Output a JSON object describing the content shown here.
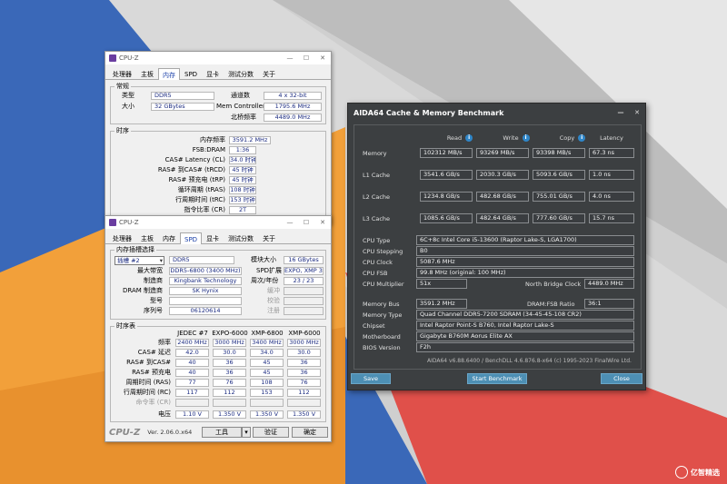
{
  "colors": {
    "bg_blue": "#3a68b8",
    "bg_orange": "#f2a03a",
    "bg_red": "#e0504a",
    "bg_gray": "#c8c8c8",
    "aida_bg": "#3c3f41",
    "aida_btn": "#4d8fb4"
  },
  "cpuz_mem": {
    "title": "CPU-Z",
    "tabs": [
      "处理器",
      "主板",
      "内存",
      "SPD",
      "显卡",
      "测试分数",
      "关于"
    ],
    "general_title": "常规",
    "type_label": "类型",
    "type_value": "DDR5",
    "size_label": "大小",
    "size_value": "32 GBytes",
    "channels_label": "通道数",
    "channels_value": "4 x 32-bit",
    "memctrl_label": "Mem Controller",
    "memctrl_value": "1795.6 MHz",
    "nb_label": "北桥频率",
    "nb_value": "4489.0 MHz",
    "timings_title": "时序",
    "rows": [
      {
        "label": "内存频率",
        "value": "3591.2 MHz"
      },
      {
        "label": "FSB:DRAM",
        "value": "1:36"
      },
      {
        "label": "CAS# Latency (CL)",
        "value": "34.0 时钟"
      },
      {
        "label": "RAS# 到CAS# (tRCD)",
        "value": "45 时钟"
      },
      {
        "label": "RAS# 预充电 (tRP)",
        "value": "45 时钟"
      },
      {
        "label": "循环周期 (tRAS)",
        "value": "108 时钟"
      },
      {
        "label": "行周期时间 (tRC)",
        "value": "153 时钟"
      },
      {
        "label": "指令比率 (CR)",
        "value": "2T"
      }
    ]
  },
  "cpuz_spd": {
    "title": "CPU-Z",
    "tabs": [
      "处理器",
      "主板",
      "内存",
      "SPD",
      "显卡",
      "测试分数",
      "关于"
    ],
    "slot_title": "内存插槽选择",
    "slot_value": "插槽 #2",
    "type_value": "DDR5",
    "module_size_label": "模块大小",
    "module_size_value": "16 GBytes",
    "max_bw_label": "最大带宽",
    "max_bw_value": "DDR5-6800 (3400 MHz)",
    "spd_ext_label": "SPD扩展",
    "spd_ext_value": "EXPO, XMP 3.0",
    "maker_label": "制造商",
    "maker_value": "Kingbank Technology",
    "week_label": "周次/年份",
    "week_value": "23 / 23",
    "dram_label": "DRAM 制造商",
    "dram_value": "SK Hynix",
    "buffered_label": "缓冲",
    "model_label": "型号",
    "check_label": "校验",
    "serial_label": "序列号",
    "serial_value": "06120614",
    "registered_label": "注册",
    "table_title": "时序表",
    "columns": [
      "JEDEC #7",
      "EXPO-6000",
      "XMP-6800",
      "XMP-6000"
    ],
    "timing_rows": [
      {
        "label": "频率",
        "values": [
          "2400 MHz",
          "3000 MHz",
          "3400 MHz",
          "3000 MHz"
        ]
      },
      {
        "label": "CAS# 延迟",
        "values": [
          "42.0",
          "30.0",
          "34.0",
          "30.0"
        ]
      },
      {
        "label": "RAS# 到CAS#",
        "values": [
          "40",
          "36",
          "45",
          "36"
        ]
      },
      {
        "label": "RAS# 预充电",
        "values": [
          "40",
          "36",
          "45",
          "36"
        ]
      },
      {
        "label": "周期时间 (RAS)",
        "values": [
          "77",
          "76",
          "108",
          "76"
        ]
      },
      {
        "label": "行周期时间 (RC)",
        "values": [
          "117",
          "112",
          "153",
          "112"
        ]
      },
      {
        "label": "命令率 (CR)",
        "values": [
          "",
          "",
          "",
          ""
        ]
      },
      {
        "label": "电压",
        "values": [
          "1.10 V",
          "1.350 V",
          "1.350 V",
          "1.350 V"
        ]
      }
    ],
    "footer_logo": "CPU-Z",
    "version": "Ver. 2.06.0.x64",
    "tools_label": "工具",
    "validate_label": "验证",
    "ok_label": "确定"
  },
  "aida": {
    "title": "AIDA64 Cache & Memory Benchmark",
    "headers": [
      "Read",
      "Write",
      "Copy",
      "Latency"
    ],
    "bench_rows": [
      {
        "label": "Memory",
        "values": [
          "102312 MB/s",
          "93269 MB/s",
          "93398 MB/s",
          "67.3 ns"
        ]
      },
      {
        "label": "L1 Cache",
        "values": [
          "3541.6 GB/s",
          "2030.3 GB/s",
          "5093.6 GB/s",
          "1.0 ns"
        ]
      },
      {
        "label": "L2 Cache",
        "values": [
          "1234.8 GB/s",
          "482.68 GB/s",
          "755.01 GB/s",
          "4.0 ns"
        ]
      },
      {
        "label": "L3 Cache",
        "values": [
          "1085.6 GB/s",
          "482.64 GB/s",
          "777.60 GB/s",
          "15.7 ns"
        ]
      }
    ],
    "cpu_type_label": "CPU Type",
    "cpu_type_value": "6C+8c Intel Core i5-13600  (Raptor Lake-S, LGA1700)",
    "cpu_stepping_label": "CPU Stepping",
    "cpu_stepping_value": "B0",
    "cpu_clock_label": "CPU Clock",
    "cpu_clock_value": "5087.6 MHz",
    "cpu_fsb_label": "CPU FSB",
    "cpu_fsb_value": "99.8 MHz  (original: 100 MHz)",
    "cpu_mult_label": "CPU Multiplier",
    "cpu_mult_value": "51x",
    "nb_clock_label": "North Bridge Clock",
    "nb_clock_value": "4489.0 MHz",
    "mem_bus_label": "Memory Bus",
    "mem_bus_value": "3591.2 MHz",
    "dram_fsb_label": "DRAM:FSB Ratio",
    "dram_fsb_value": "36:1",
    "mem_type_label": "Memory Type",
    "mem_type_value": "Quad Channel DDR5-7200 SDRAM  (34-45-45-108 CR2)",
    "chipset_label": "Chipset",
    "chipset_value": "Intel Raptor Point-S B760, Intel Raptor Lake-S",
    "mobo_label": "Motherboard",
    "mobo_value": "Gigabyte B760M Aorus Elite AX",
    "bios_label": "BIOS Version",
    "bios_value": "F2h",
    "footer": "AIDA64 v6.88.6400 / BenchDLL 4.6.876.8-x64  (c) 1995-2023 FinalWire Ltd.",
    "save_label": "Save",
    "start_label": "Start Benchmark",
    "close_label": "Close"
  },
  "watermark": "亿智精选"
}
